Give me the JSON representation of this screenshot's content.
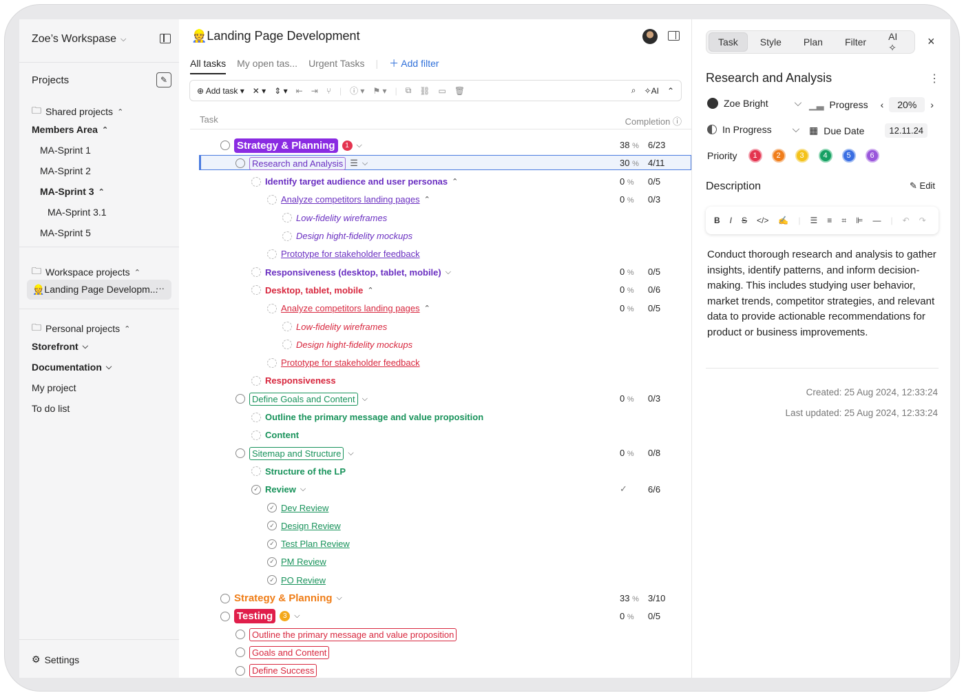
{
  "sidebar": {
    "workspace": "Zoe’s Workspase",
    "projects_label": "Projects",
    "shared": "Shared projects",
    "members": "Members Area",
    "sprint1": "MA-Sprint 1",
    "sprint2": "MA-Sprint 2",
    "sprint3": "MA-Sprint 3",
    "sprint31": "MA-Sprint 3.1",
    "sprint5": "MA-Sprint 5",
    "workspace_projects": "Workspace projects",
    "landing": "👷Landing Page Developm...",
    "more": "···",
    "personal": "Personal projects",
    "storefront": "Storefront",
    "documentation": "Documentation",
    "my_project": "My project",
    "todo": "To do list",
    "settings": "Settings"
  },
  "main": {
    "title": "👷Landing Page Development",
    "tabs": [
      "All tasks",
      "My open tas...",
      "Urgent Tasks"
    ],
    "add_filter": "Add filter",
    "add_task": "Add task",
    "ai": "AI",
    "col_task": "Task",
    "col_completion": "Completion",
    "rows": [
      {
        "text": "Strategy & Planning",
        "pct": "38",
        "cnt": "6/23",
        "badge": "1"
      },
      {
        "text": "Research and Analysis",
        "pct": "30",
        "cnt": "4/11"
      },
      {
        "text": "Identify target audience and user personas",
        "pct": "0",
        "cnt": "0/5"
      },
      {
        "text": "Analyze competitors landing pages",
        "pct": "0",
        "cnt": "0/3"
      },
      {
        "text": "Low-fidelity wireframes"
      },
      {
        "text": "Design hight-fidelity mockups"
      },
      {
        "text": "Prototype for stakeholder feedback"
      },
      {
        "text": "Responsiveness (desktop, tablet, mobile)",
        "pct": "0",
        "cnt": "0/5"
      },
      {
        "text": "Desktop, tablet, mobile",
        "pct": "0",
        "cnt": "0/6"
      },
      {
        "text": "Analyze competitors landing pages",
        "pct": "0",
        "cnt": "0/5"
      },
      {
        "text": "Low-fidelity wireframes"
      },
      {
        "text": "Design hight-fidelity mockups"
      },
      {
        "text": "Prototype for stakeholder feedback"
      },
      {
        "text": "Responsiveness"
      },
      {
        "text": "Define Goals and Content",
        "pct": "0",
        "cnt": "0/3"
      },
      {
        "text": "Outline the primary message and value proposition"
      },
      {
        "text": "Content"
      },
      {
        "text": "Sitemap and Structure",
        "pct": "0",
        "cnt": "0/8"
      },
      {
        "text": "Structure of the LP"
      },
      {
        "text": "Review",
        "cnt": "6/6"
      },
      {
        "text": "Dev Review"
      },
      {
        "text": "Design Review"
      },
      {
        "text": "Test Plan Review"
      },
      {
        "text": "PM Review"
      },
      {
        "text": "PO Review"
      },
      {
        "text": "Strategy & Planning",
        "pct": "33",
        "cnt": "3/10"
      },
      {
        "text": "Testing",
        "pct": "0",
        "cnt": "0/5",
        "badge": "3"
      },
      {
        "text": "Outline the primary message and value proposition"
      },
      {
        "text": "Goals and Content"
      },
      {
        "text": "Define Success"
      }
    ],
    "pct_sign": "%"
  },
  "panel": {
    "tabs": [
      "Task",
      "Style",
      "Plan",
      "Filter",
      "AI"
    ],
    "title": "Research and Analysis",
    "assignee": "Zoe Bright",
    "progress_label": "Progress",
    "progress_value": "20%",
    "status": "In Progress",
    "due_label": "Due Date",
    "due_value": "12.11.24",
    "priority_label": "Priority",
    "priorities": [
      "1",
      "2",
      "3",
      "4",
      "5",
      "6"
    ],
    "description_label": "Description",
    "edit": "Edit",
    "description": "Conduct thorough research and analysis to gather insights, identify patterns, and inform decision-making. This includes studying user behavior, market trends, competitor strategies, and relevant data to provide actionable recommendations for product or business improvements.",
    "created": "Created: 25 Aug 2024, 12:33:24",
    "updated": "Last updated: 25 Aug 2024, 12:33:24"
  },
  "colors": {
    "purple": "#6a2fc1",
    "red": "#d7263d",
    "green": "#17925a",
    "orange": "#ef7d17",
    "accent": "#2e6fd9"
  }
}
